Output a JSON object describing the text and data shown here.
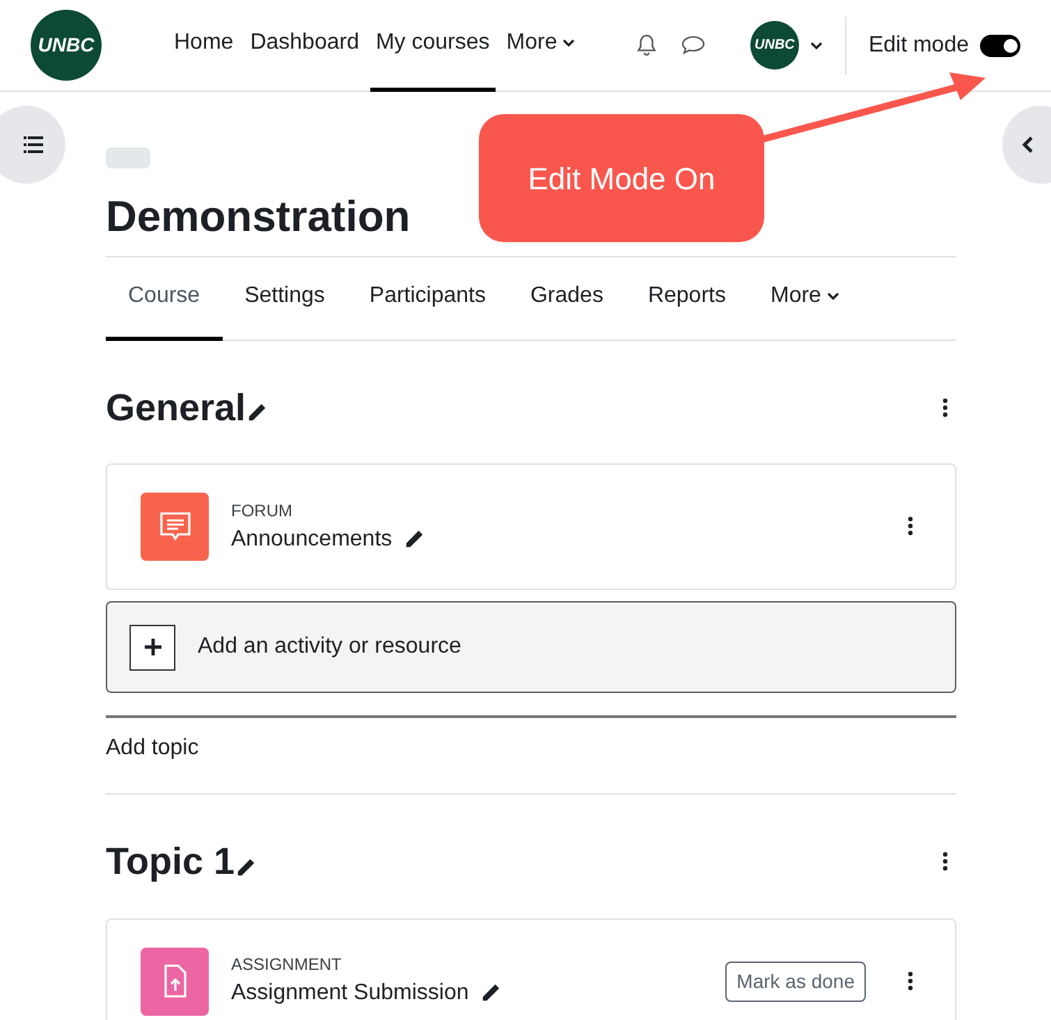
{
  "navbar": {
    "logo_text": "UNBC",
    "links": [
      {
        "label": "Home",
        "selected": false,
        "dropdown": false
      },
      {
        "label": "Dashboard",
        "selected": false,
        "dropdown": false
      },
      {
        "label": "My courses",
        "selected": true,
        "dropdown": false
      },
      {
        "label": "More",
        "selected": false,
        "dropdown": true
      }
    ],
    "avatar_text": "UNBC",
    "edit_mode": {
      "label": "Edit mode",
      "on": true
    }
  },
  "annotation": {
    "text": "Edit Mode On"
  },
  "course": {
    "title": "Demonstration",
    "tabs": [
      {
        "label": "Course",
        "selected": true,
        "dropdown": false
      },
      {
        "label": "Settings",
        "selected": false,
        "dropdown": false
      },
      {
        "label": "Participants",
        "selected": false,
        "dropdown": false
      },
      {
        "label": "Grades",
        "selected": false,
        "dropdown": false
      },
      {
        "label": "Reports",
        "selected": false,
        "dropdown": false
      },
      {
        "label": "More",
        "selected": false,
        "dropdown": true
      }
    ]
  },
  "sections": [
    {
      "title": "General",
      "activities": [
        {
          "kind": "forum",
          "type_label": "FORUM",
          "name": "Announcements"
        }
      ],
      "add_activity": "Add an activity or resource",
      "add_topic": "Add topic"
    },
    {
      "title": "Topic 1",
      "activities": [
        {
          "kind": "assignment",
          "type_label": "ASSIGNMENT",
          "name": "Assignment Submission",
          "completion_button": "Mark as done"
        }
      ]
    }
  ]
}
